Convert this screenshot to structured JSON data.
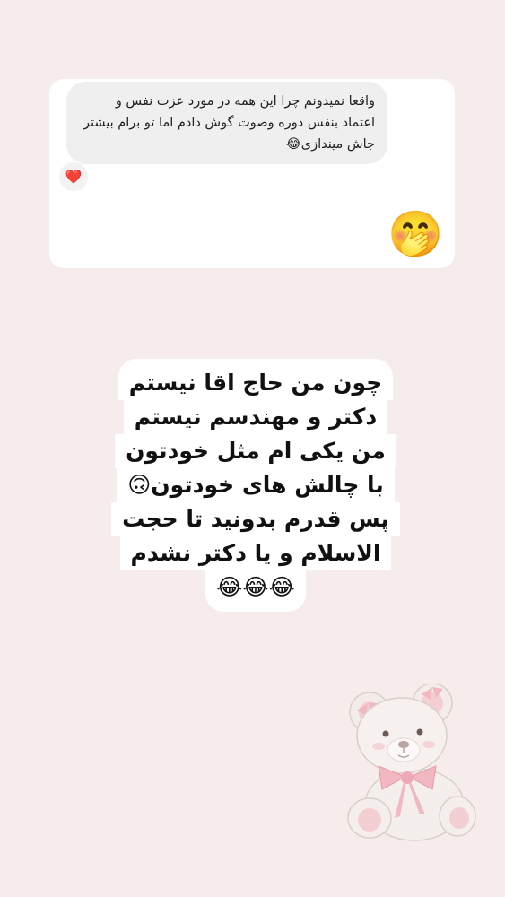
{
  "reply": {
    "message": "واقعا نمیدونم چرا این همه در مورد عزت نفس و اعتماد بنفس دوره وصوت گوش دادم اما تو برام بیشتر جاش میندازی😂",
    "reaction": "❤️",
    "sticker": "🤭"
  },
  "caption": {
    "lines": [
      "چون من حاج اقا نیستم",
      "دکتر و مهندسم نیستم",
      "من یکی ام مثل خودتون",
      "با چالش های خودتون🙃",
      "پس قدرم بدونید تا حجت",
      "الاسلام و یا دکتر نشدم",
      "😂😂😂"
    ]
  },
  "decoration": {
    "bear_icon": "teddy-bear-icon",
    "background_color": "#f6ecec"
  }
}
